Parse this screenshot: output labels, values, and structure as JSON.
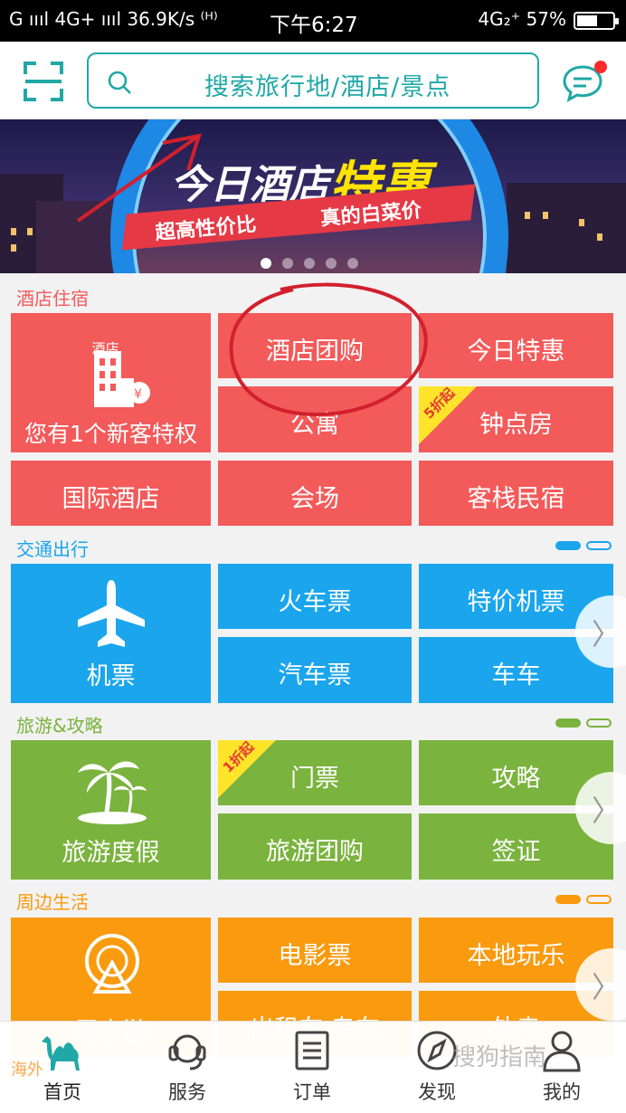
{
  "status_bar": {
    "left": "G ıııl 4G+ ıııl 36.9K/s ⁽ᴴ⁾",
    "time": "下午6:27",
    "right": "4G₂⁺ 57%",
    "battery_percent": 57
  },
  "header": {
    "search_placeholder": "搜索旅行地/酒店/景点",
    "scan_icon": "scan-icon",
    "message_icon": "message-icon"
  },
  "banner": {
    "title_white": "今日酒店",
    "title_yellow": "特惠",
    "sub_left": "超高性价比",
    "sub_right": "真的白菜价",
    "slide_count": 5,
    "active_slide": 0
  },
  "sections": {
    "hotel": {
      "title": "酒店住宿",
      "color": "#f35a5a",
      "main_top": "酒店",
      "main_label": "您有1个新客特权",
      "items": [
        "酒店团购",
        "今日特惠",
        "公寓",
        "钟点房",
        "国际酒店",
        "会场",
        "客栈民宿"
      ],
      "discount_tag": "5折起"
    },
    "transport": {
      "title": "交通出行",
      "color": "#1aa5ed",
      "main_label": "机票",
      "items": [
        "火车票",
        "特价机票",
        "汽车票",
        "车车"
      ]
    },
    "travel": {
      "title": "旅游&攻略",
      "color": "#7ab33d",
      "main_label": "旅游度假",
      "items": [
        "门票",
        "攻略",
        "旅游团购",
        "签证"
      ],
      "discount_tag": "1折起"
    },
    "nearby": {
      "title": "周边生活",
      "color": "#f99a0f",
      "main_label": "周末游",
      "items": [
        "电影票",
        "本地玩乐",
        "出租车·专车",
        "外卖"
      ]
    }
  },
  "peek_text": "海外",
  "watermark": "搜狗指南",
  "tab_bar": {
    "tabs": [
      {
        "label": "首页",
        "icon": "camel-icon",
        "active": true
      },
      {
        "label": "服务",
        "icon": "headset-icon",
        "active": false
      },
      {
        "label": "订单",
        "icon": "order-icon",
        "active": false
      },
      {
        "label": "发现",
        "icon": "compass-icon",
        "active": false
      },
      {
        "label": "我的",
        "icon": "user-icon",
        "active": false
      }
    ]
  }
}
